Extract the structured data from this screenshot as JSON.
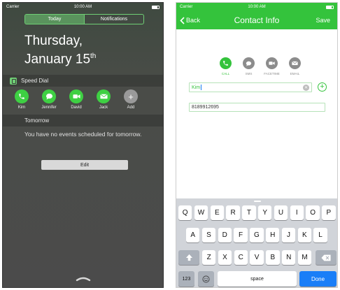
{
  "left": {
    "status": {
      "carrier": "Carrier",
      "time": "10:00 AM"
    },
    "tabs": [
      {
        "label": "Today"
      },
      {
        "label": "Notifications"
      }
    ],
    "date_line1": "Thursday,",
    "date_line2": "January 15",
    "date_suffix": "th",
    "speed_dial_title": "Speed Dial",
    "contacts": [
      {
        "name": "Kim",
        "icon": "phone-icon"
      },
      {
        "name": "Jennifer",
        "icon": "message-icon"
      },
      {
        "name": "David",
        "icon": "video-icon"
      },
      {
        "name": "Jack",
        "icon": "email-icon"
      },
      {
        "name": "Add",
        "icon": "plus-icon"
      }
    ],
    "tomorrow_title": "Tomorrow",
    "no_events": "You have no events scheduled for tomorrow.",
    "edit_label": "Edit"
  },
  "right": {
    "status": {
      "carrier": "Carrier",
      "time": "10:00 AM"
    },
    "back_label": "Back",
    "title": "Contact Info",
    "save_label": "Save",
    "actions": [
      {
        "label": "CALL",
        "icon": "phone-icon"
      },
      {
        "label": "SMS",
        "icon": "message-icon"
      },
      {
        "label": "FACETIME",
        "icon": "video-icon"
      },
      {
        "label": "EMAIL",
        "icon": "email-icon"
      }
    ],
    "name_value": "Kim",
    "number_value": "8189912695",
    "keyboard": {
      "row1": [
        "Q",
        "W",
        "E",
        "R",
        "T",
        "Y",
        "U",
        "I",
        "O",
        "P"
      ],
      "row2": [
        "A",
        "S",
        "D",
        "F",
        "G",
        "H",
        "J",
        "K",
        "L"
      ],
      "row3": [
        "Z",
        "X",
        "C",
        "V",
        "B",
        "N",
        "M"
      ],
      "numbers_label": "123",
      "space_label": "space",
      "done_label": "Done"
    },
    "accent_color": "#34c33c"
  }
}
